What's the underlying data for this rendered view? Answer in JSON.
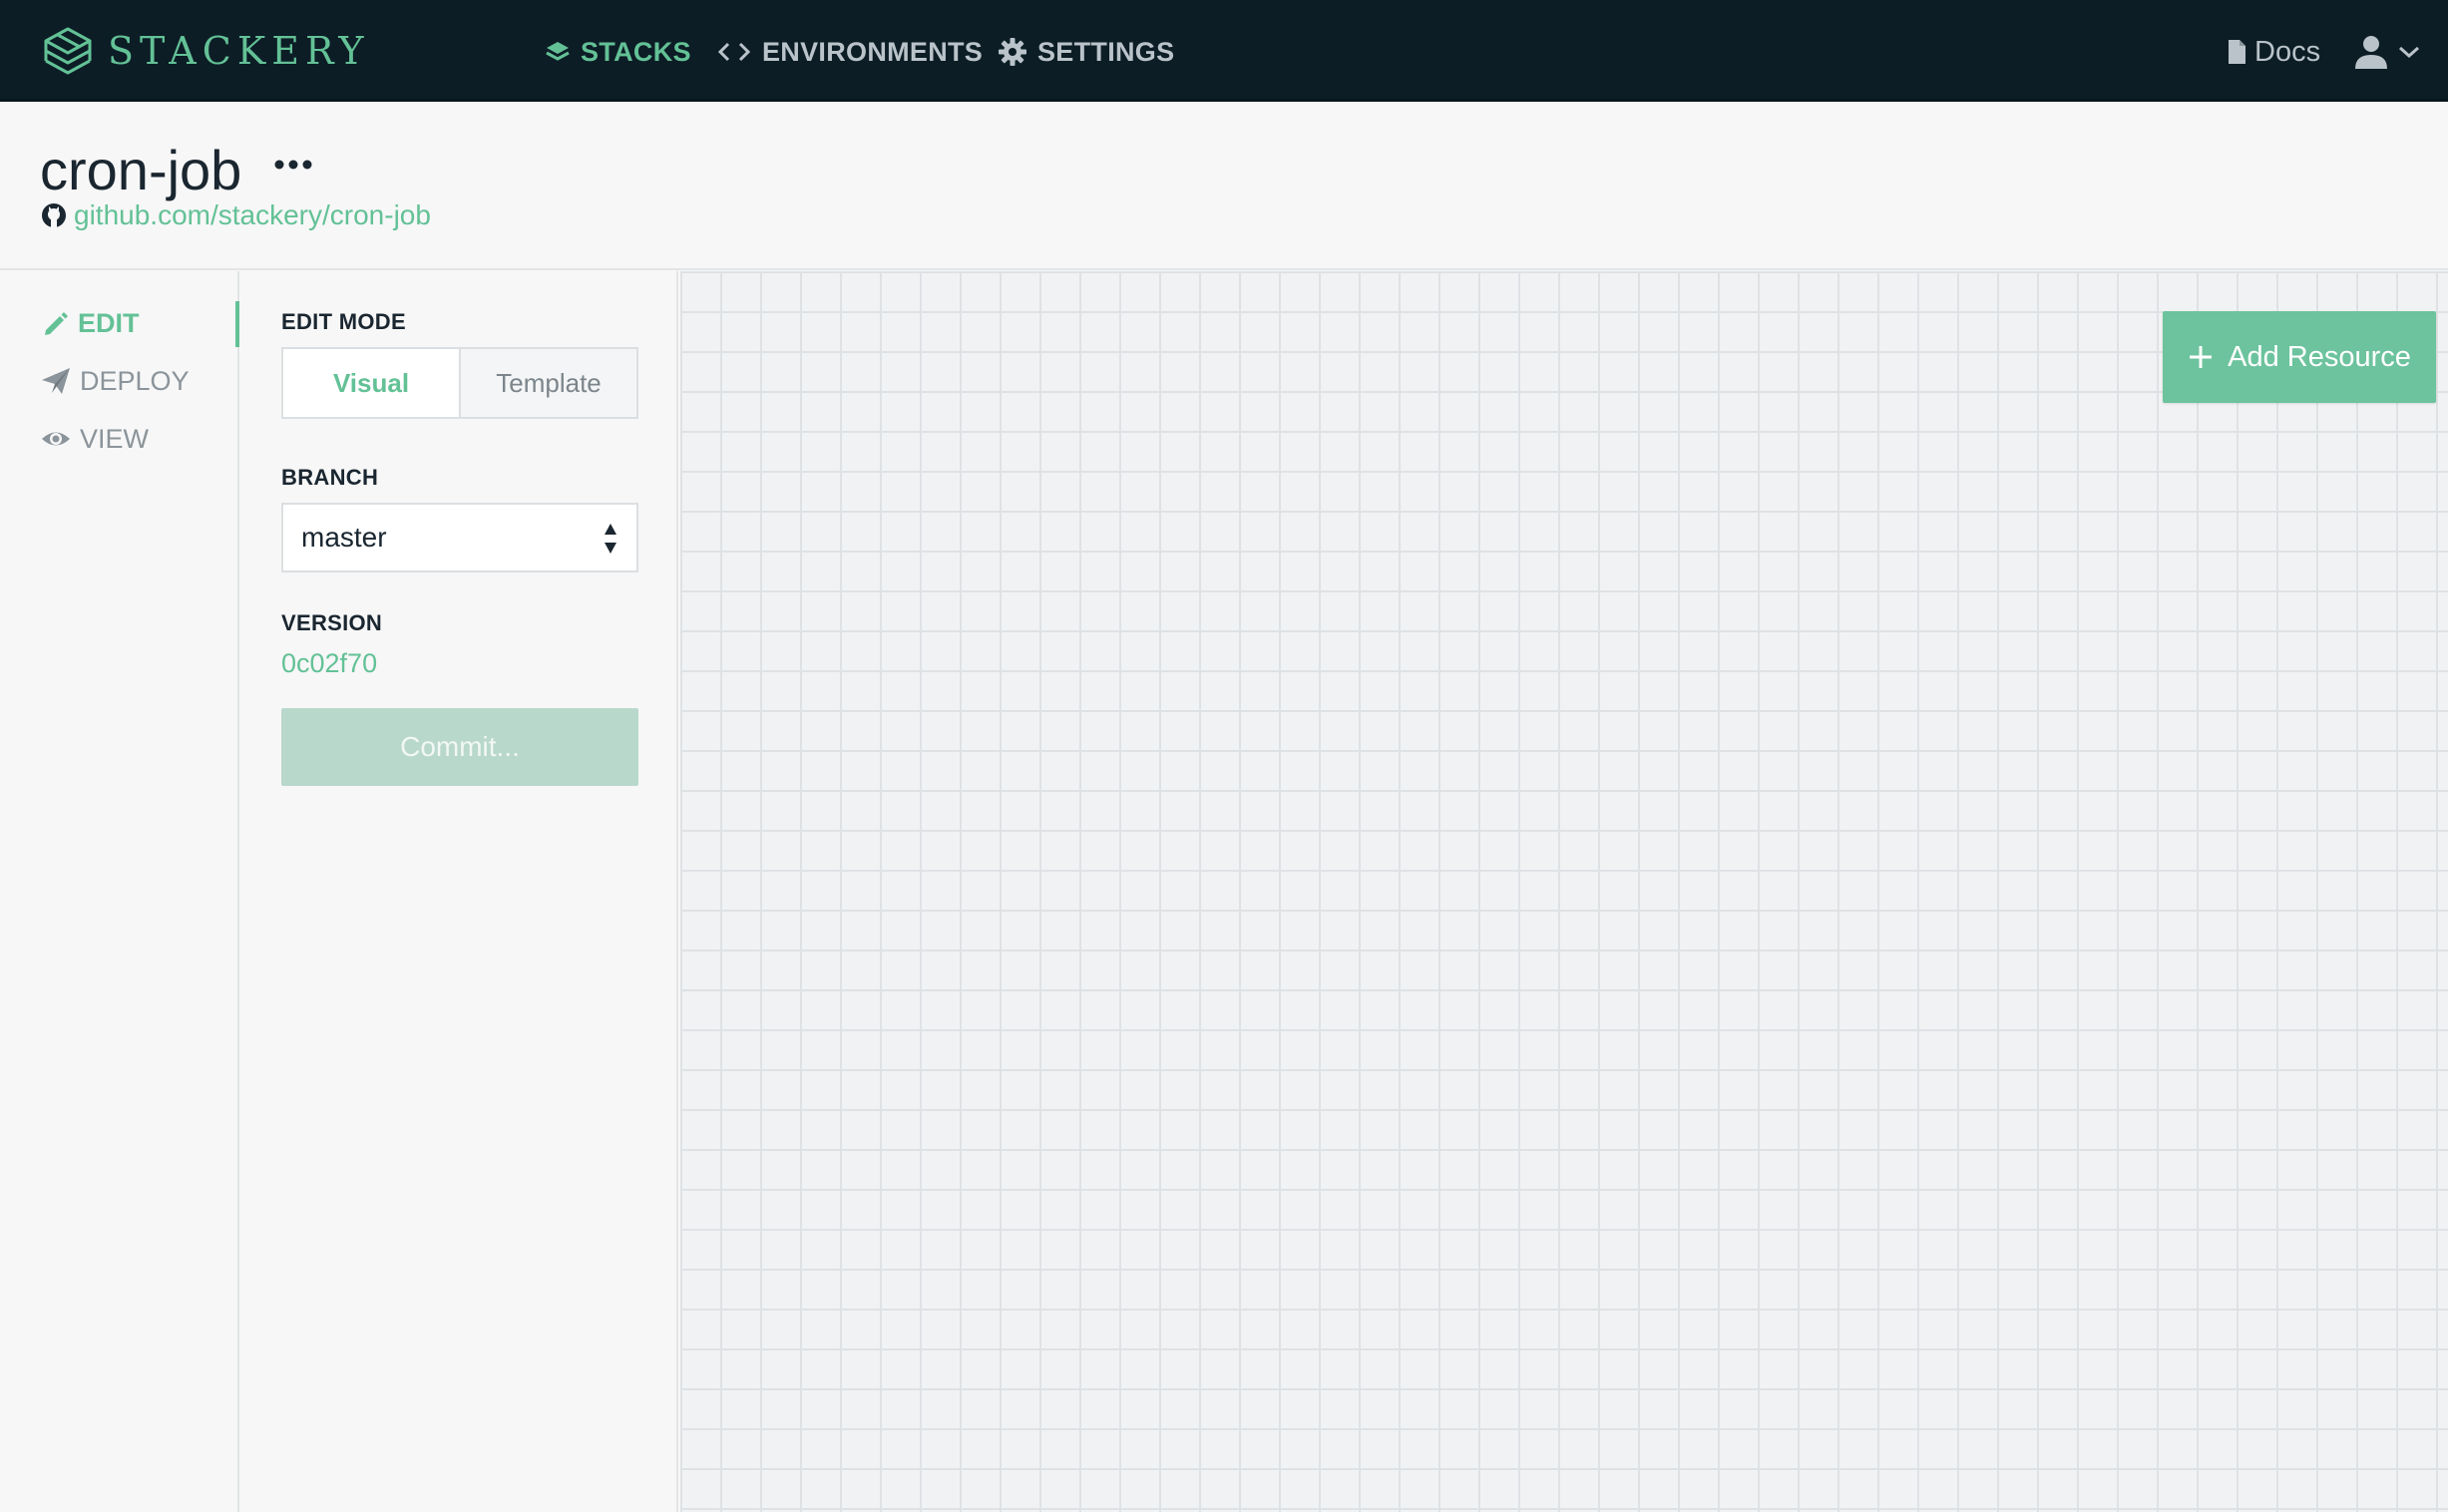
{
  "brand": {
    "name": "STACKERY"
  },
  "nav": {
    "items": [
      {
        "label": "STACKS",
        "active": true
      },
      {
        "label": "ENVIRONMENTS",
        "active": false
      },
      {
        "label": "SETTINGS",
        "active": false
      }
    ],
    "docs_label": "Docs"
  },
  "stack": {
    "title": "cron-job",
    "repo": "github.com/stackery/cron-job"
  },
  "sidenav": {
    "items": [
      {
        "label": "EDIT",
        "active": true
      },
      {
        "label": "DEPLOY",
        "active": false
      },
      {
        "label": "VIEW",
        "active": false
      }
    ]
  },
  "panel": {
    "edit_mode_label": "EDIT MODE",
    "modes": {
      "visual": "Visual",
      "template": "Template",
      "selected": "Visual"
    },
    "branch_label": "BRANCH",
    "branch_value": "master",
    "version_label": "VERSION",
    "version_value": "0c02f70",
    "commit_label": "Commit..."
  },
  "canvas": {
    "add_resource_label": "Add Resource"
  },
  "colors": {
    "accent": "#63c196",
    "nav_bg": "#0c1d26",
    "commit_disabled": "#b8d8cb"
  }
}
